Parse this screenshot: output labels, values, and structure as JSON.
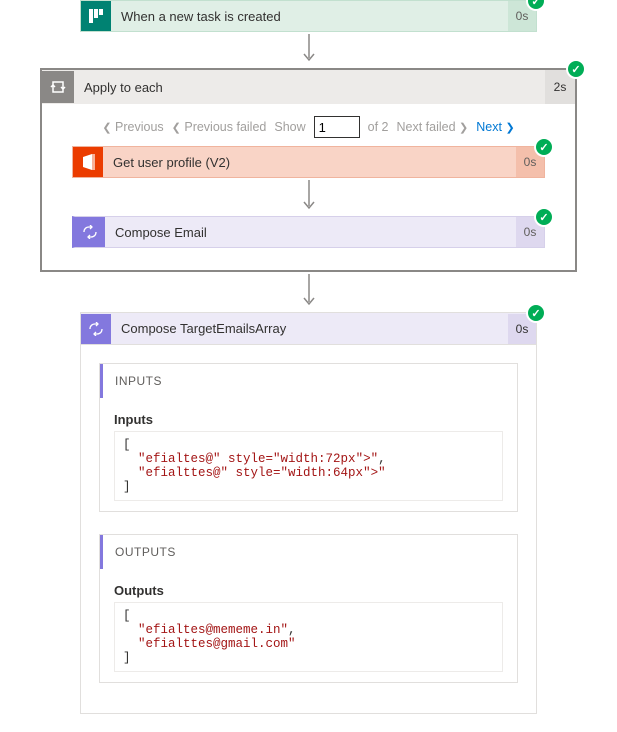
{
  "trigger": {
    "title": "When a new task is created",
    "duration": "0s",
    "icon": "planner-icon"
  },
  "loop": {
    "title": "Apply to each",
    "duration": "2s",
    "pager": {
      "prev": "Previous",
      "prev_failed": "Previous failed",
      "show_label": "Show",
      "page": "1",
      "of_label": "of 2",
      "next_failed": "Next failed",
      "next": "Next"
    },
    "steps": [
      {
        "id": "getuser",
        "title": "Get user profile (V2)",
        "duration": "0s",
        "icon": "office-icon"
      },
      {
        "id": "composeemail",
        "title": "Compose Email",
        "duration": "0s",
        "icon": "compose-icon"
      }
    ]
  },
  "expanded": {
    "title": "Compose TargetEmailsArray",
    "duration": "0s",
    "inputs": {
      "header": "INPUTS",
      "label": "Inputs",
      "lines": [
        "[",
        "  \"efialtes@REDACT1\",",
        "  \"efialttes@REDACT2\"",
        "]"
      ]
    },
    "outputs": {
      "header": "OUTPUTS",
      "label": "Outputs",
      "lines": [
        "[",
        "  \"efialtes@mememe.in\",",
        "  \"efialttes@gmail.com\"",
        "]"
      ]
    }
  }
}
